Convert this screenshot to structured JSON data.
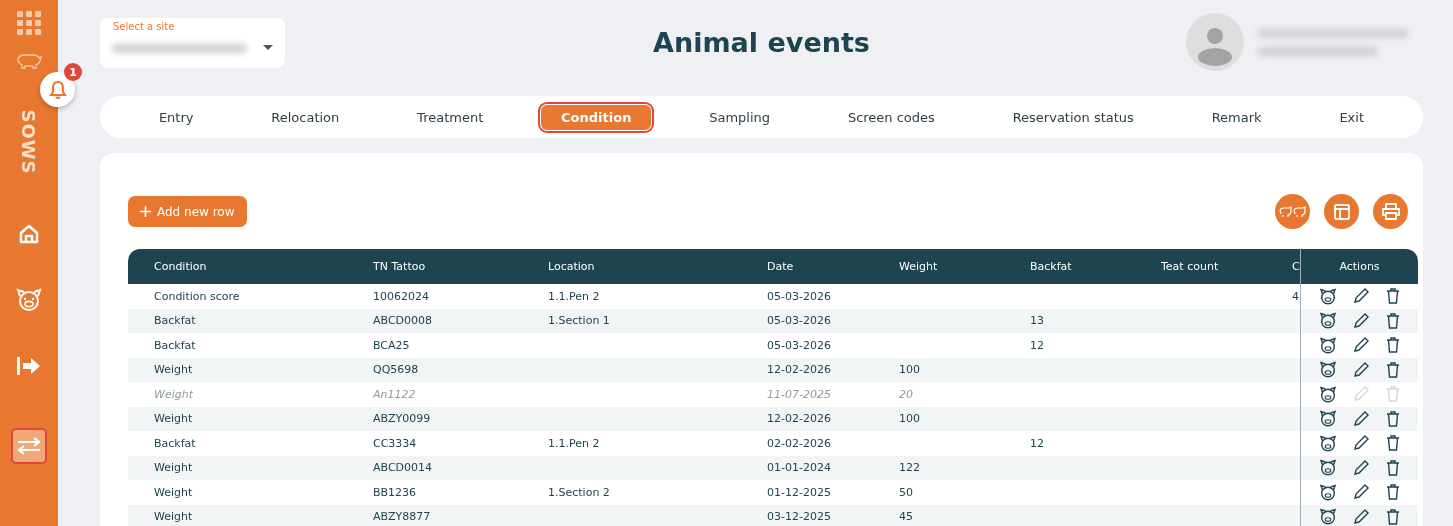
{
  "sidebar": {
    "notification_count": "1",
    "label": "SOWS",
    "items": [
      {
        "kind": "home",
        "selected": false
      },
      {
        "kind": "pig",
        "selected": false
      },
      {
        "kind": "exit",
        "selected": false
      },
      {
        "kind": "swap",
        "selected": true
      }
    ]
  },
  "site_select": {
    "label": "Select a site"
  },
  "title": "Animal events",
  "tabs": [
    {
      "label": "Entry",
      "selected": false
    },
    {
      "label": "Relocation",
      "selected": false
    },
    {
      "label": "Treatment",
      "selected": false
    },
    {
      "label": "Condition",
      "selected": true
    },
    {
      "label": "Sampling",
      "selected": false
    },
    {
      "label": "Screen codes",
      "selected": false
    },
    {
      "label": "Reservation status",
      "selected": false
    },
    {
      "label": "Remark",
      "selected": false
    },
    {
      "label": "Exit",
      "selected": false
    }
  ],
  "add_button": "Add new row",
  "table": {
    "columns": [
      "Condition",
      "TN Tattoo",
      "Location",
      "Date",
      "Weight",
      "Backfat",
      "Teat count",
      "C"
    ],
    "actions_heading": "Actions",
    "rows": [
      {
        "condition": "Condition score",
        "tn_tattoo": "10062024",
        "location": "1.1.Pen 2",
        "date": "05-03-2026",
        "column_8": "4",
        "disabled": false
      },
      {
        "condition": "Backfat",
        "tn_tattoo": "ABCD0008",
        "location": "1.Section 1",
        "date": "05-03-2026",
        "backfat": "13",
        "disabled": false
      },
      {
        "condition": "Backfat",
        "tn_tattoo": "BCA25",
        "date": "05-03-2026",
        "backfat": "12",
        "disabled": false
      },
      {
        "condition": "Weight",
        "tn_tattoo": "QQ5698",
        "date": "12-02-2026",
        "weight": "100",
        "disabled": false
      },
      {
        "condition": "Weight",
        "tn_tattoo": "An1122",
        "date": "11-07-2025",
        "weight": "20",
        "disabled": true
      },
      {
        "condition": "Weight",
        "tn_tattoo": "ABZY0099",
        "date": "12-02-2026",
        "weight": "100",
        "disabled": false
      },
      {
        "condition": "Backfat",
        "tn_tattoo": "CC3334",
        "location": "1.1.Pen 2",
        "date": "02-02-2026",
        "backfat": "12",
        "disabled": false
      },
      {
        "condition": "Weight",
        "tn_tattoo": "ABCD0014",
        "date": "01-01-2024",
        "weight": "122",
        "disabled": false
      },
      {
        "condition": "Weight",
        "tn_tattoo": "BB1236",
        "location": "1.Section 2",
        "date": "01-12-2025",
        "weight": "50",
        "disabled": false
      },
      {
        "condition": "Weight",
        "tn_tattoo": "ABZY8877",
        "date": "03-12-2025",
        "weight": "45",
        "disabled": false
      }
    ]
  }
}
